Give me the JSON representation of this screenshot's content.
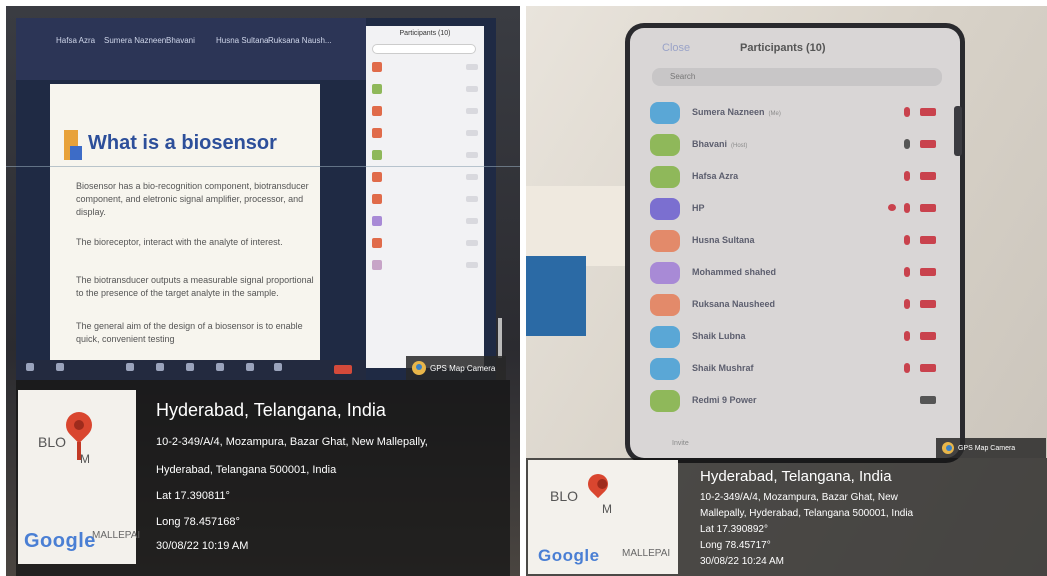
{
  "left_photo": {
    "zoom_top": {
      "names": [
        "Hafsa Azra",
        "Sumera Nazneen",
        "Bhavani",
        "Husna Sultana",
        "Ruksana Naush..."
      ]
    },
    "slide": {
      "title": "What is a biosensor",
      "paragraphs": [
        "Biosensor has a bio-recognition component, biotransducer component, and eletronic signal amplifier, processor, and display.",
        "The bioreceptor, interact with the analyte of interest.",
        "The biotransducer outputs a measurable signal proportional to the presence of the target analyte in the sample.",
        "The general aim of the design of a biosensor is to enable quick, convenient testing"
      ]
    },
    "participants_panel": {
      "title": "Participants (10)"
    },
    "gps_badge": "GPS Map Camera",
    "location": {
      "title": "Hyderabad, Telangana, India",
      "address_line1": "10-2-349/A/4, Mozampura, Bazar Ghat, New Mallepally,",
      "address_line2": "Hyderabad, Telangana 500001, India",
      "lat": "Lat 17.390811°",
      "long": "Long 78.457168°",
      "datetime": "30/08/22 10:19 AM"
    },
    "map": {
      "bloom": "BLO",
      "m": "M",
      "google": "Google",
      "mallepa": "MALLEPAI"
    }
  },
  "right_photo": {
    "phone": {
      "close_label": "Close",
      "title": "Participants (10)",
      "search_placeholder": "Search",
      "participants": [
        {
          "name": "Sumera Nazneen",
          "tag": "(Me)",
          "color": "#5aa7d6"
        },
        {
          "name": "Bhavani",
          "tag": "(Host)",
          "color": "#8fb85a"
        },
        {
          "name": "Hafsa Azra",
          "tag": "",
          "color": "#8fb85a"
        },
        {
          "name": "HP",
          "tag": "",
          "color": "#7b6fd0"
        },
        {
          "name": "Husna Sultana",
          "tag": "",
          "color": "#e38a6a"
        },
        {
          "name": "Mohammed shahed",
          "tag": "",
          "color": "#a88ad6"
        },
        {
          "name": "Ruksana Nausheed",
          "tag": "",
          "color": "#e38a6a"
        },
        {
          "name": "Shaik Lubna",
          "tag": "",
          "color": "#5aa7d6"
        },
        {
          "name": "Shaik Mushraf",
          "tag": "",
          "color": "#5aa7d6"
        },
        {
          "name": "Redmi 9 Power",
          "tag": "",
          "color": "#8fb85a"
        }
      ],
      "invite_label": "Invite"
    },
    "gps_badge": "GPS Map Camera",
    "location": {
      "title": "Hyderabad, Telangana, India",
      "address_line1": "10-2-349/A/4, Mozampura, Bazar Ghat, New",
      "address_line2": "Mallepally, Hyderabad, Telangana 500001, India",
      "lat": "Lat 17.390892°",
      "long": "Long 78.45717°",
      "datetime": "30/08/22 10:24 AM"
    },
    "map": {
      "bloom": "BLO",
      "m": "M",
      "google": "Google",
      "mallepa": "MALLEPAI"
    }
  }
}
